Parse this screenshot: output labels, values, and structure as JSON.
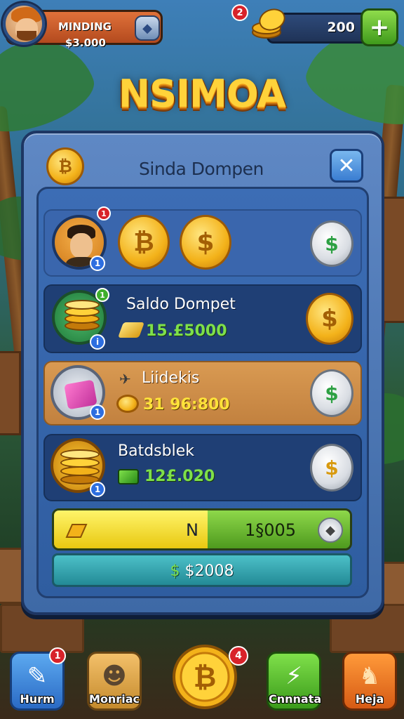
{
  "player": {
    "name": "MINDING",
    "money": "$3.000",
    "notifications": "2"
  },
  "currency": {
    "coins": "200",
    "add_label": "+"
  },
  "logo": "NSIMOA",
  "panel": {
    "title": "Sinda Dompen",
    "close_label": "✕",
    "rows": [
      {
        "badge_top": "1",
        "badge_info": "1"
      },
      {
        "title": "Saldo Dompet",
        "value": "15.£5000",
        "badge_top": "1",
        "badge_info": "i"
      },
      {
        "title": "Liidekis",
        "value": "31 96:800",
        "badge_info": "1"
      },
      {
        "title": "Batdsblek",
        "value": "12£.020",
        "badge_info": "1"
      }
    ],
    "progress": {
      "label": "N",
      "value": "1§005"
    },
    "total": {
      "value": "$2008"
    }
  },
  "nav": [
    {
      "label": "Hurm",
      "badge": "1"
    },
    {
      "label": "Monriac"
    },
    {
      "label": "",
      "badge": "4"
    },
    {
      "label": "Cnnnata"
    },
    {
      "label": "Heja"
    }
  ]
}
